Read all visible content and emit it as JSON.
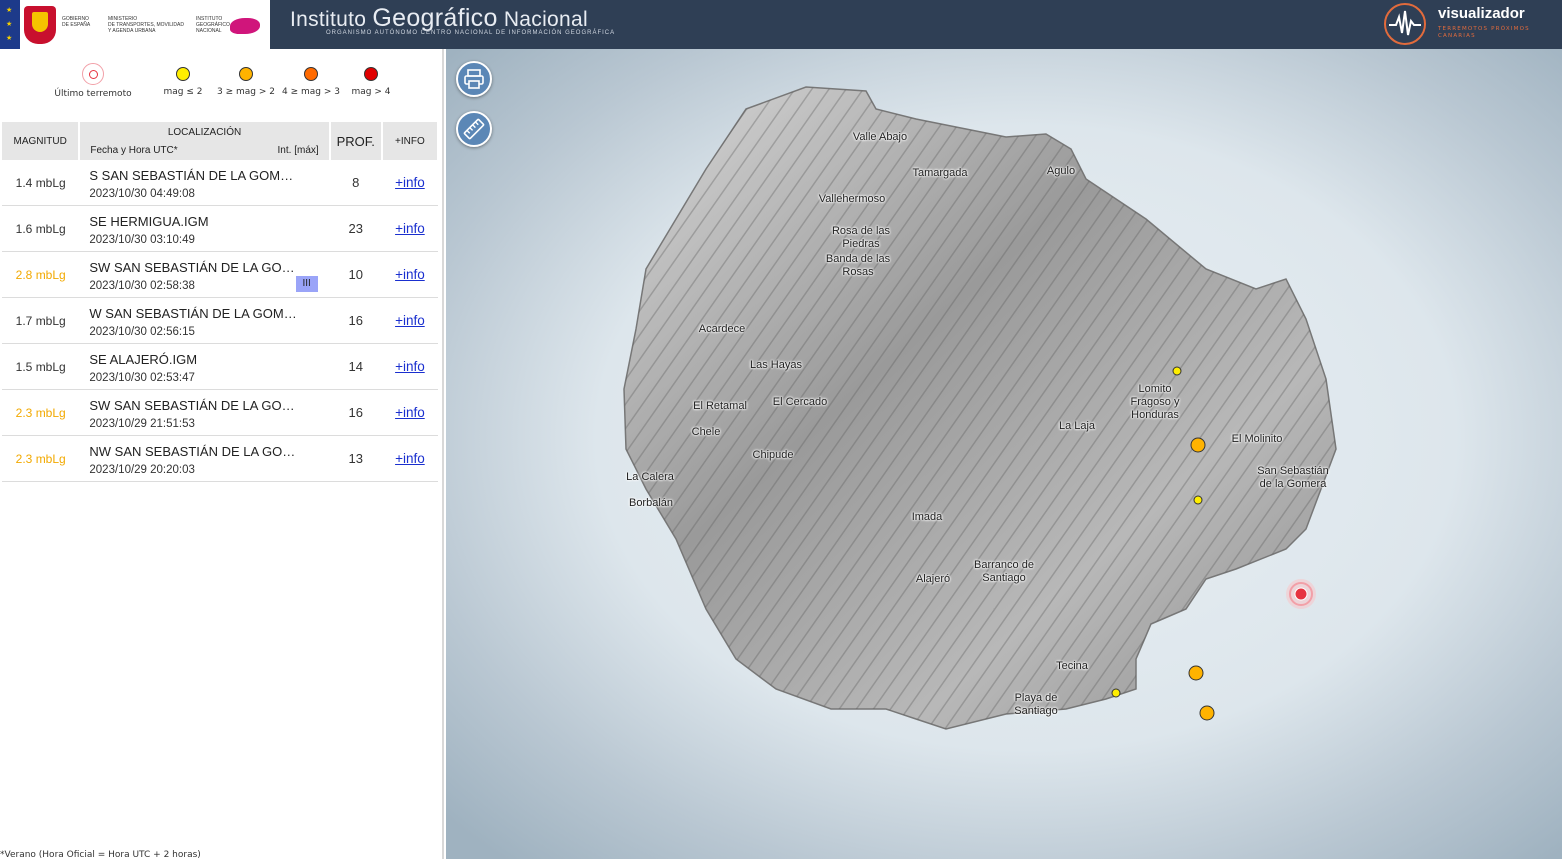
{
  "header": {
    "gov_lines": [
      "GOBIERNO",
      "DE ESPAÑA"
    ],
    "ministry_lines": [
      "MINISTERIO",
      "DE TRANSPORTES, MOVILIDAD",
      "Y AGENDA URBANA"
    ],
    "ign_small_lines": [
      "INSTITUTO",
      "GEOGRÁFICO",
      "NACIONAL"
    ],
    "ign_title_a": "Instituto ",
    "ign_title_b": "Geográfico",
    "ign_title_c": " Nacional",
    "ign_subtitle": "ORGANISMO AUTÓNOMO CENTRO NACIONAL DE INFORMACIÓN GEOGRÁFICA",
    "viz_title": "visualizador",
    "viz_subtitle": "TERREMOTOS PRÓXIMOS CANARIAS"
  },
  "legend": {
    "last_label": "Último terremoto",
    "items": [
      {
        "label": "mag ≤ 2",
        "color": "#ffee00"
      },
      {
        "label": "3 ≥ mag > 2",
        "color": "#ffb300"
      },
      {
        "label": "4 ≥ mag > 3",
        "color": "#ff6a00"
      },
      {
        "label": "mag > 4",
        "color": "#e00000"
      }
    ]
  },
  "table": {
    "headers": {
      "mag": "MAGNITUD",
      "loc": "LOCALIZACIÓN",
      "loc_date": "Fecha y Hora UTC*",
      "loc_int": "Int. [máx]",
      "prof": "PROF.",
      "info": "+INFO"
    },
    "rows": [
      {
        "mag": "1.4 mbLg",
        "place": "S SAN SEBASTIÁN DE LA GOMERA.I",
        "date": "2023/10/30 04:49:08",
        "intensity": "",
        "prof": "8",
        "info": "+info",
        "color": "#333333"
      },
      {
        "mag": "1.6 mbLg",
        "place": "SE HERMIGUA.IGM",
        "date": "2023/10/30 03:10:49",
        "intensity": "",
        "prof": "23",
        "info": "+info",
        "color": "#333333"
      },
      {
        "mag": "2.8 mbLg",
        "place": "SW SAN SEBASTIÁN DE LA GOMERA.IGM",
        "date": "2023/10/30 02:58:38",
        "intensity": "III",
        "prof": "10",
        "info": "+info",
        "color": "#f2a900"
      },
      {
        "mag": "1.7 mbLg",
        "place": "W SAN SEBASTIÁN DE LA GOMERA.IGM",
        "date": "2023/10/30 02:56:15",
        "intensity": "",
        "prof": "16",
        "info": "+info",
        "color": "#333333"
      },
      {
        "mag": "1.5 mbLg",
        "place": "SE ALAJERÓ.IGM",
        "date": "2023/10/30 02:53:47",
        "intensity": "",
        "prof": "14",
        "info": "+info",
        "color": "#333333"
      },
      {
        "mag": "2.3 mbLg",
        "place": "SW SAN SEBASTIÁN DE LA GOMERA.IGM",
        "date": "2023/10/29 21:51:53",
        "intensity": "",
        "prof": "16",
        "info": "+info",
        "color": "#f2a900"
      },
      {
        "mag": "2.3 mbLg",
        "place": "NW SAN SEBASTIÁN DE LA GOMERA.IGM",
        "date": "2023/10/29 20:20:03",
        "intensity": "",
        "prof": "13",
        "info": "+info",
        "color": "#f2a900"
      }
    ]
  },
  "footnote": "*Verano (Hora Oficial = Hora UTC + 2 horas)",
  "map": {
    "place_names": {
      "valle_abajo": "Valle Abajo",
      "tamargada": "Tamargada",
      "agulo": "Agulo",
      "vallehermoso": "Vallehermoso",
      "rosa": "Rosa de las\nPiedras",
      "banda": "Banda de las\nRosas",
      "acardece": "Acardece",
      "las_hayas": "Las Hayas",
      "el_retamal": "El Retamal",
      "el_cercado": "El Cercado",
      "chele": "Chele",
      "chipude": "Chipude",
      "la_calera": "La Calera",
      "borbalan": "Borbalán",
      "imada": "Imada",
      "alajero": "Alajeró",
      "barranco": "Barranco de\nSantiago",
      "tecina": "Tecina",
      "playa": "Playa de\nSantiago",
      "la_laja": "La Laja",
      "lomito": "Lomito\nFragoso y\nHonduras",
      "el_molinito": "El Molinito",
      "san_sebastian": "San Sebastián\nde la Gomera"
    },
    "colors": {
      "small": "#ffee00",
      "medium": "#ffb300",
      "latest": "#e63340"
    }
  }
}
